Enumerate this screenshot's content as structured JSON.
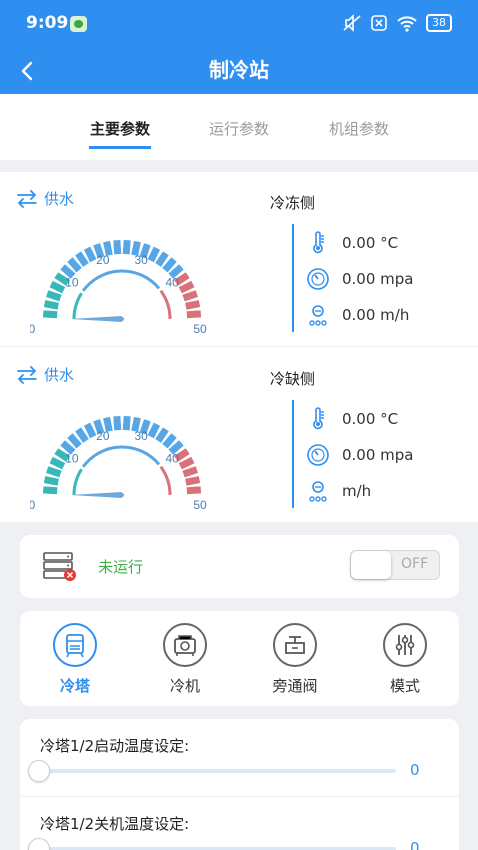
{
  "status_bar": {
    "time": "9:09",
    "battery": "38"
  },
  "header": {
    "title": "制冷站"
  },
  "tabs": [
    {
      "label": "主要参数",
      "active": true
    },
    {
      "label": "运行参数",
      "active": false
    },
    {
      "label": "机组参数",
      "active": false
    }
  ],
  "sections": [
    {
      "supply_label": "供水",
      "side_title": "冷冻侧",
      "gauge": {
        "min": 0,
        "max": 50,
        "value": 0,
        "tick_labels": [
          "0",
          "10",
          "20",
          "30",
          "40",
          "50"
        ]
      },
      "metrics": [
        {
          "icon": "thermometer-icon",
          "text": "0.00 °C"
        },
        {
          "icon": "pressure-gauge-icon",
          "text": "0.00 mpa"
        },
        {
          "icon": "flow-icon",
          "text": "0.00 m/h"
        }
      ]
    },
    {
      "supply_label": "供水",
      "side_title": "冷缺侧",
      "gauge": {
        "min": 0,
        "max": 50,
        "value": 0,
        "tick_labels": [
          "0",
          "10",
          "20",
          "30",
          "40",
          "50"
        ]
      },
      "metrics": [
        {
          "icon": "thermometer-icon",
          "text": "0.00 °C"
        },
        {
          "icon": "pressure-gauge-icon",
          "text": "0.00 mpa"
        },
        {
          "icon": "flow-icon",
          "text": "m/h"
        }
      ]
    }
  ],
  "status_card": {
    "status_text": "未运行",
    "toggle_text": "OFF",
    "toggle_on": false
  },
  "modes": [
    {
      "label": "冷塔",
      "icon": "cooling-tower-icon",
      "active": true
    },
    {
      "label": "冷机",
      "icon": "chiller-icon",
      "active": false
    },
    {
      "label": "旁通阀",
      "icon": "bypass-valve-icon",
      "active": false
    },
    {
      "label": "模式",
      "icon": "mode-sliders-icon",
      "active": false
    }
  ],
  "settings": [
    {
      "label": "冷塔1/2启动温度设定:",
      "value": "0"
    },
    {
      "label": "冷塔1/2关机温度设定:",
      "value": "0"
    }
  ],
  "colors": {
    "primary": "#2f8ff0",
    "gauge_teal": "#36b8b8",
    "gauge_blue": "#57a6e6",
    "gauge_red": "#d9707a",
    "status_green": "#3cb04a"
  }
}
